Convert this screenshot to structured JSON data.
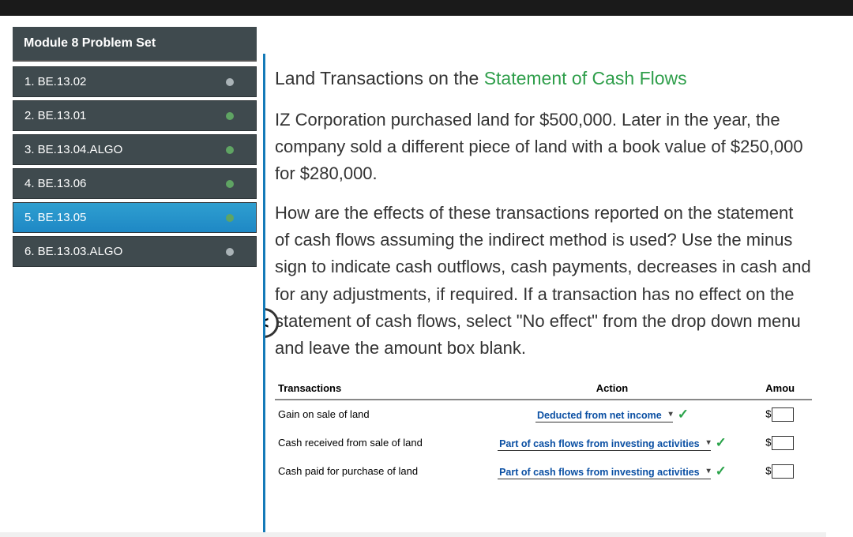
{
  "module_header": "Module 8 Problem Set",
  "nav_items": [
    {
      "label": "1. BE.13.02",
      "status": "neutral",
      "active": false
    },
    {
      "label": "2. BE.13.01",
      "status": "done",
      "active": false
    },
    {
      "label": "3. BE.13.04.ALGO",
      "status": "done",
      "active": false
    },
    {
      "label": "4. BE.13.06",
      "status": "done",
      "active": false
    },
    {
      "label": "5. BE.13.05",
      "status": "done",
      "active": true
    },
    {
      "label": "6. BE.13.03.ALGO",
      "status": "neutral",
      "active": false
    }
  ],
  "title_prefix": "Land Transactions on the ",
  "title_green": "Statement of Cash Flows",
  "para1": "IZ Corporation purchased land for $500,000. Later in the year, the company sold a different piece of land with a book value of $250,000 for $280,000.",
  "para2": "How are the effects of these transactions reported on the statement of cash flows assuming the indirect method is used? Use the minus sign to indicate cash outflows, cash payments, decreases in cash and for any adjustments, if required. If a transaction has no effect on the statement of cash flows, select \"No effect\" from the drop down menu and leave the amount box blank.",
  "columns": {
    "c1": "Transactions",
    "c2": "Action",
    "c3": "Amou"
  },
  "rows": [
    {
      "txn": "Gain on sale of land",
      "action": "Deducted from net income",
      "amount_prefix": "$"
    },
    {
      "txn": "Cash received from sale of land",
      "action": "Part of cash flows from investing activities",
      "amount_prefix": "$"
    },
    {
      "txn": "Cash paid for purchase of land",
      "action": "Part of cash flows from investing activities",
      "amount_prefix": "$"
    }
  ],
  "icons": {
    "headset": "🎧",
    "help": "?"
  },
  "collapse": "<"
}
